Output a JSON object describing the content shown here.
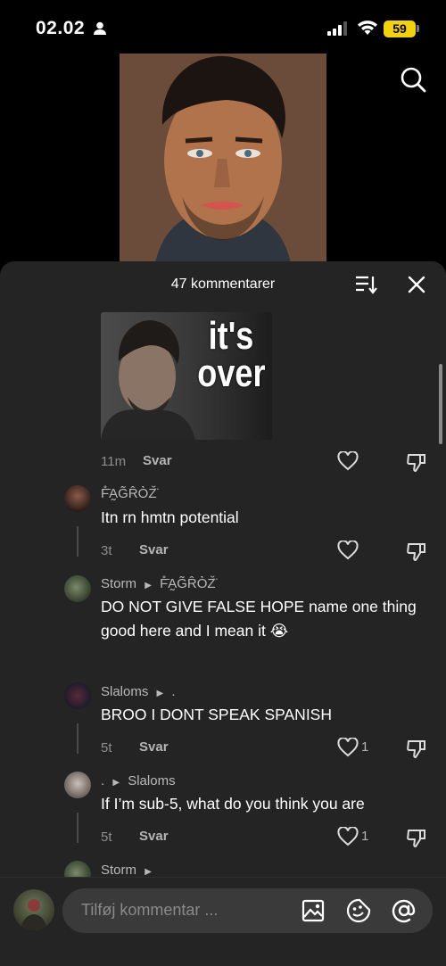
{
  "status_bar": {
    "time": "02.02",
    "battery": "59"
  },
  "sheet": {
    "title": "47 kommentarer"
  },
  "thumbnail": {
    "line1": "it's",
    "line2": "over"
  },
  "comments": [
    {
      "time": "11m",
      "reply": "Svar"
    },
    {
      "name": "F̊̄A̰G̃R̂Ȯ̀Z̆̈",
      "text": "Itn rn hmtn potential",
      "time": "3t",
      "reply": "Svar"
    },
    {
      "name": "Storm",
      "reply_to": "F̊̄A̰G̃R̂Ȯ̀Z̆̈",
      "text": "DO NOT GIVE FALSE HOPE name one thing good here and I mean it 😭"
    },
    {
      "name": "Slaloms",
      "reply_to": ".",
      "text": "BROO I DONT SPEAK SPANISH",
      "time": "5t",
      "reply": "Svar",
      "likes": "1"
    },
    {
      "name": ".",
      "reply_to": "Slaloms",
      "text": "If I’m sub-5, what do you think you are",
      "time": "5t",
      "reply": "Svar",
      "likes": "1"
    },
    {
      "name": "Storm"
    }
  ],
  "input": {
    "placeholder": "Tilføj kommentar ..."
  },
  "colors": {
    "sheet_bg": "#242424",
    "battery": "#f2d10e"
  }
}
